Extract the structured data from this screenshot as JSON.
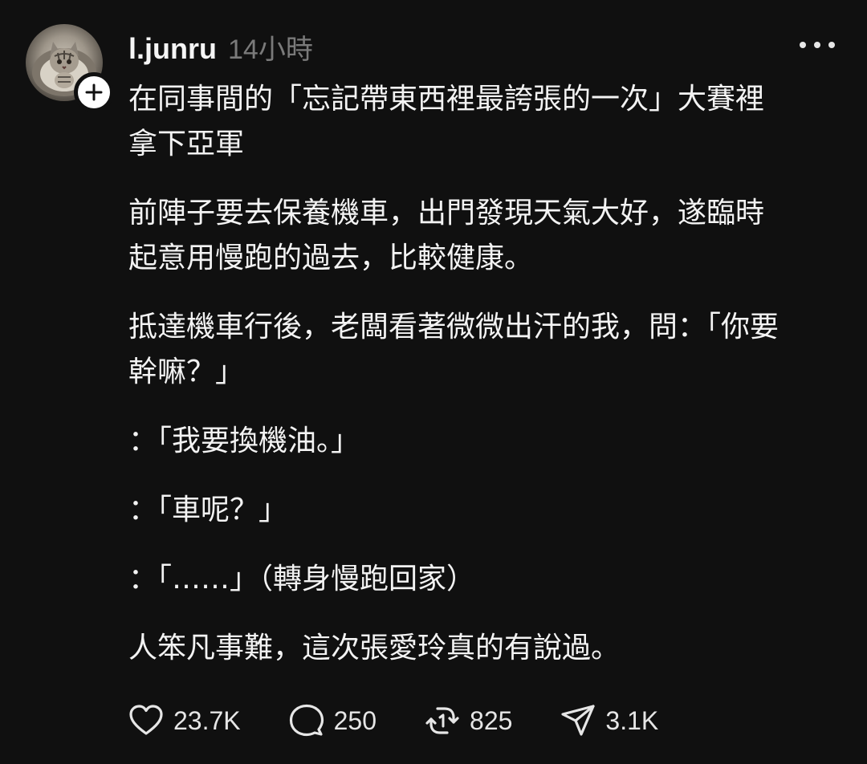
{
  "post": {
    "username": "l.junru",
    "time": "14小時",
    "paragraphs": [
      "在同事間的「忘記帶東西裡最誇張的一次」大賽裡\n拿下亞軍",
      "前陣子要去保養機車，出門發現天氣大好，遂臨時\n起意用慢跑的過去，比較健康。",
      "抵達機車行後，老闆看著微微出汗的我，問：「你要\n幹嘛？」",
      "：「我要換機油。」",
      "：「車呢？」",
      "：「……」（轉身慢跑回家）",
      "人笨凡事難，這次張愛玲真的有說過。"
    ],
    "actions": {
      "likes": "23.7K",
      "comments": "250",
      "reposts": "825",
      "shares": "3.1K"
    }
  },
  "icons": {
    "avatar": "cat-avatar",
    "follow": "plus-icon",
    "more": "more-dots-icon",
    "like": "heart-icon",
    "comment": "comment-bubble-icon",
    "repost": "repost-icon",
    "share": "send-icon"
  },
  "colors": {
    "background": "#101010",
    "text": "#f3f3f3",
    "muted": "#7a7a7a"
  }
}
